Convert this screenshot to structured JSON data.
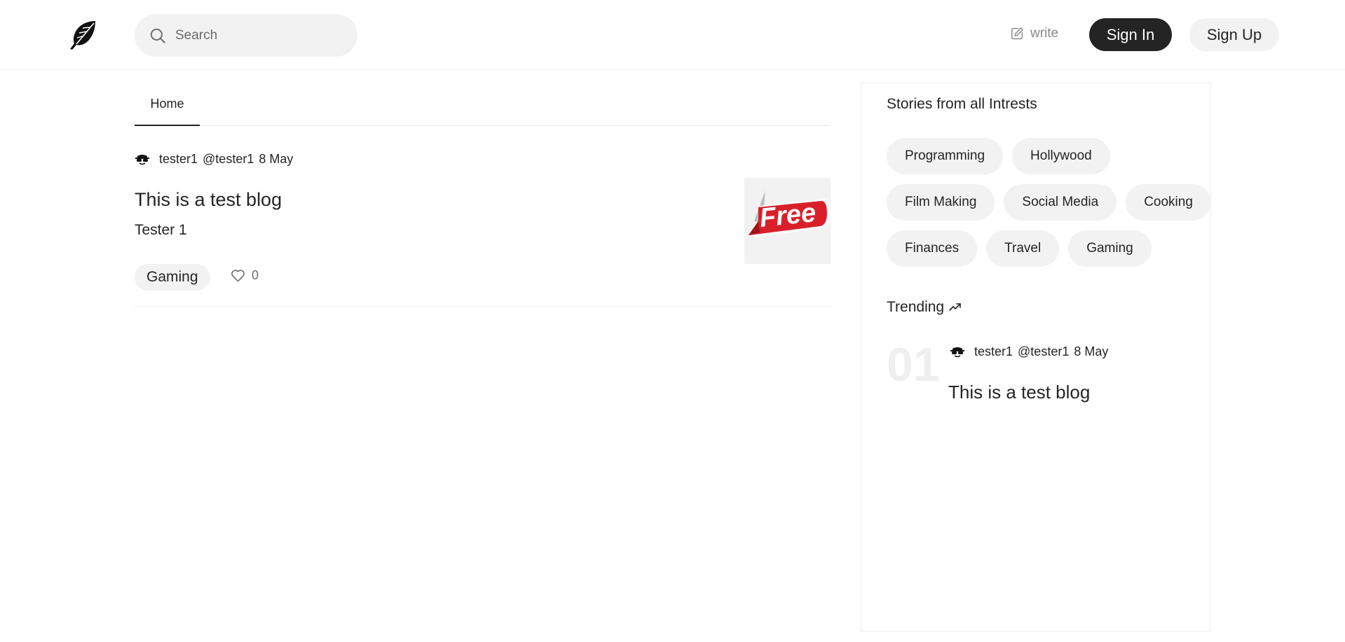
{
  "nav": {
    "logo_icon": "feather-icon",
    "search_placeholder": "Search",
    "write_label": "write",
    "signin_label": "Sign In",
    "signup_label": "Sign Up"
  },
  "tabs": [
    {
      "label": "Home",
      "active": true
    }
  ],
  "feed": [
    {
      "author": "tester1",
      "handle": "@tester1",
      "date": "8 May",
      "title": "This is a test blog",
      "subtitle": "Tester 1",
      "tag": "Gaming",
      "likes": "0",
      "thumbnail_text": "Free"
    }
  ],
  "sidebar": {
    "interests_heading": "Stories from all Intrests",
    "interests": [
      [
        "Programming",
        "Hollywood"
      ],
      [
        "Film Making",
        "Social Media",
        "Cooking"
      ],
      [
        "Finances",
        "Travel",
        "Gaming"
      ]
    ],
    "trending_heading": "Trending",
    "trending": [
      {
        "rank": "01",
        "author": "tester1",
        "handle": "@tester1",
        "date": "8 May",
        "title": "This is a test blog"
      }
    ]
  },
  "colors": {
    "primary_dark": "#242424",
    "chip_bg": "#f2f2f2",
    "muted_text": "#6b6b6b",
    "badge_red": "#d9202a"
  }
}
